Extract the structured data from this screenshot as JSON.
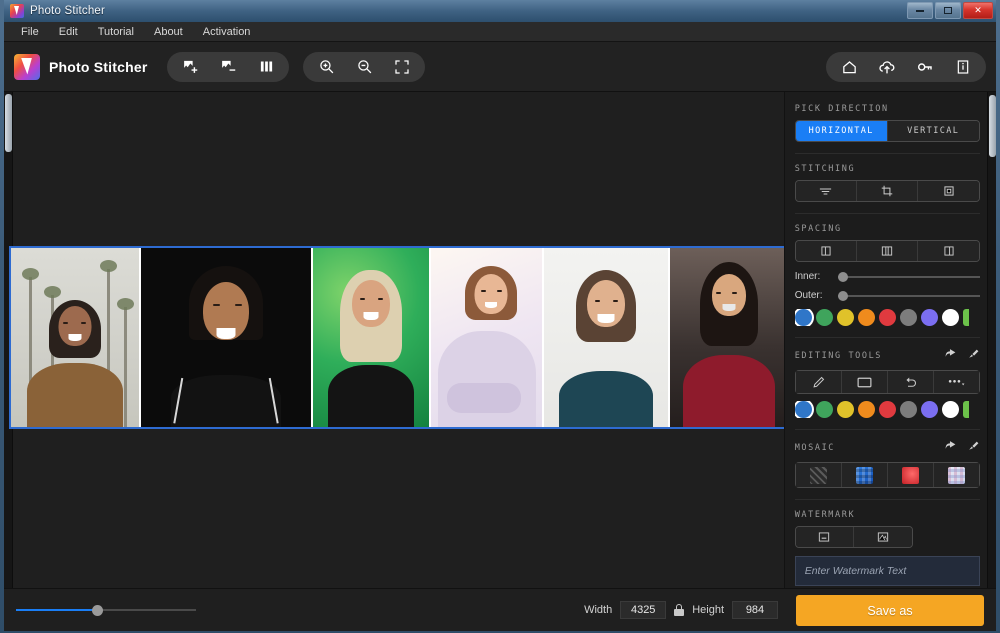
{
  "window": {
    "title": "Photo Stitcher",
    "app_icon": "app-logo-icon",
    "minimize": "minimize-icon",
    "maximize": "maximize-icon",
    "close": "close-icon"
  },
  "menu": {
    "items": [
      {
        "label": "File"
      },
      {
        "label": "Edit"
      },
      {
        "label": "Tutorial"
      },
      {
        "label": "About"
      },
      {
        "label": "Activation"
      }
    ]
  },
  "toolbar": {
    "brand": "Photo Stitcher",
    "left_tools": [
      {
        "name": "add-image-icon",
        "tip": "Add Image"
      },
      {
        "name": "remove-image-icon",
        "tip": "Remove Image"
      },
      {
        "name": "grid-view-icon",
        "tip": "Grid View"
      }
    ],
    "zoom_tools": [
      {
        "name": "zoom-in-icon",
        "tip": "Zoom In"
      },
      {
        "name": "zoom-out-icon",
        "tip": "Zoom Out"
      },
      {
        "name": "fit-screen-icon",
        "tip": "Fit to Screen"
      }
    ],
    "right_tools": [
      {
        "name": "home-icon",
        "tip": "Home"
      },
      {
        "name": "cloud-upload-icon",
        "tip": "Upload"
      },
      {
        "name": "key-icon",
        "tip": "Activation Key"
      },
      {
        "name": "document-info-icon",
        "tip": "Info"
      }
    ]
  },
  "canvas": {
    "photos": [
      {
        "caption": "woman-palm-trees"
      },
      {
        "caption": "man-black-hat"
      },
      {
        "caption": "woman-braids-green"
      },
      {
        "caption": "woman-lavender-sweater"
      },
      {
        "caption": "person-teal-sweater"
      },
      {
        "caption": "woman-red-dress"
      }
    ]
  },
  "panel": {
    "pick_direction": {
      "label": "PICK DIRECTION",
      "options": [
        {
          "label": "HORIZONTAL",
          "selected": true
        },
        {
          "label": "VERTICAL",
          "selected": false
        }
      ]
    },
    "stitching": {
      "label": "STITCHING",
      "options": [
        {
          "name": "align-lines-icon"
        },
        {
          "name": "crop-frame-icon"
        },
        {
          "name": "expand-frame-icon"
        }
      ]
    },
    "spacing": {
      "label": "SPACING",
      "options": [
        {
          "name": "spacing-left-icon"
        },
        {
          "name": "spacing-center-icon"
        },
        {
          "name": "spacing-right-icon"
        }
      ],
      "inner_label": "Inner:",
      "outer_label": "Outer:",
      "inner_value": 0,
      "outer_value": 0
    },
    "spacing_colors": [
      {
        "hex": "#2f76c8",
        "selected": true
      },
      {
        "hex": "#3fa45c",
        "selected": false
      },
      {
        "hex": "#e0c22a",
        "selected": false
      },
      {
        "hex": "#ef8b1d",
        "selected": false
      },
      {
        "hex": "#e03a3f",
        "selected": false
      },
      {
        "hex": "#7d7d7d",
        "selected": false
      },
      {
        "hex": "#7b6ef0",
        "selected": false
      },
      {
        "hex": "#ffffff",
        "selected": false
      },
      {
        "hex": "#6cc24a",
        "selected": false
      }
    ],
    "editing_tools": {
      "label": "EDITING TOOLS",
      "undo": "undo-arrow-icon",
      "clear": "clear-brush-icon",
      "options": [
        {
          "name": "pen-tool-icon"
        },
        {
          "name": "rectangle-tool-icon"
        },
        {
          "name": "undo-tool-icon"
        },
        {
          "name": "more-options-icon"
        }
      ]
    },
    "editing_colors": [
      {
        "hex": "#2f76c8",
        "selected": true
      },
      {
        "hex": "#3fa45c",
        "selected": false
      },
      {
        "hex": "#e0c22a",
        "selected": false
      },
      {
        "hex": "#ef8b1d",
        "selected": false
      },
      {
        "hex": "#e03a3f",
        "selected": false
      },
      {
        "hex": "#7d7d7d",
        "selected": false
      },
      {
        "hex": "#7b6ef0",
        "selected": false
      },
      {
        "hex": "#ffffff",
        "selected": false
      },
      {
        "hex": "#6cc24a",
        "selected": false
      }
    ],
    "mosaic": {
      "label": "MOSAIC",
      "undo": "undo-arrow-icon",
      "clear": "clear-brush-icon",
      "options": [
        {
          "name": "hatch-pattern-icon"
        },
        {
          "name": "blue-pixelate-icon"
        },
        {
          "name": "red-blur-icon"
        },
        {
          "name": "light-pixelate-icon"
        }
      ]
    },
    "watermark": {
      "label": "WATERMARK",
      "options": [
        {
          "name": "watermark-text-icon"
        },
        {
          "name": "watermark-image-icon"
        }
      ],
      "input_placeholder": "Enter Watermark Text",
      "input_value": ""
    },
    "watermark_colors": [
      {
        "hex": "#2f76c8",
        "selected": true
      },
      {
        "hex": "#3fa45c",
        "selected": false
      },
      {
        "hex": "#e0c22a",
        "selected": false
      },
      {
        "hex": "#ef8b1d",
        "selected": false
      },
      {
        "hex": "#e03a3f",
        "selected": false
      },
      {
        "hex": "#7d7d7d",
        "selected": false
      },
      {
        "hex": "#7b6ef0",
        "selected": false
      },
      {
        "hex": "#ffffff",
        "selected": false
      },
      {
        "hex": "#6cc24a",
        "selected": false
      }
    ]
  },
  "status": {
    "zoom_value": 45,
    "width_label": "Width",
    "width_value": "4325",
    "lock_icon": "lock-icon",
    "height_label": "Height",
    "height_value": "984",
    "save_label": "Save as"
  },
  "colors": {
    "accent_blue": "#1a7ef5",
    "save_orange": "#f5a623",
    "panel_bg": "#1c1c1c",
    "canvas_bg": "#1f1f1f"
  }
}
